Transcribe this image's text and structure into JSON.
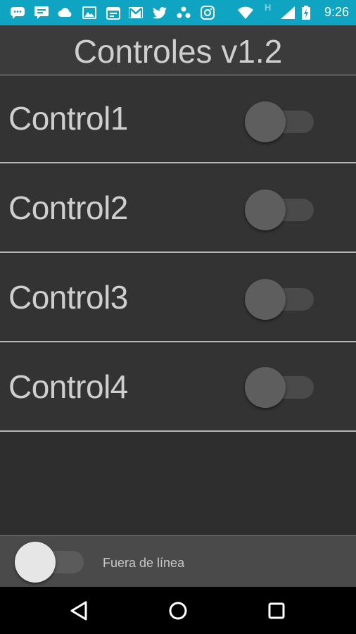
{
  "status_bar": {
    "time": "9:26",
    "icons": [
      "chat-icon",
      "message-icon",
      "cloud-icon",
      "image-icon",
      "calendar-icon",
      "gmail-icon",
      "twitter-icon",
      "dots-icon",
      "instagram-icon",
      "wifi-icon",
      "h-signal-icon",
      "cell-signal-icon",
      "battery-icon"
    ],
    "network_type": "H"
  },
  "app": {
    "title": "Controles v1.2"
  },
  "controls": [
    {
      "label": "Control1",
      "on": false
    },
    {
      "label": "Control2",
      "on": false
    },
    {
      "label": "Control3",
      "on": false
    },
    {
      "label": "Control4",
      "on": false
    }
  ],
  "bottom": {
    "offline_label": "Fuera de línea",
    "offline_on": false
  },
  "nav": {
    "icons": [
      "back-icon",
      "home-icon",
      "recents-icon"
    ]
  },
  "colors": {
    "status_bar": "#0fa4c1",
    "background": "#2e2e2e",
    "text": "#cfcfcf"
  }
}
